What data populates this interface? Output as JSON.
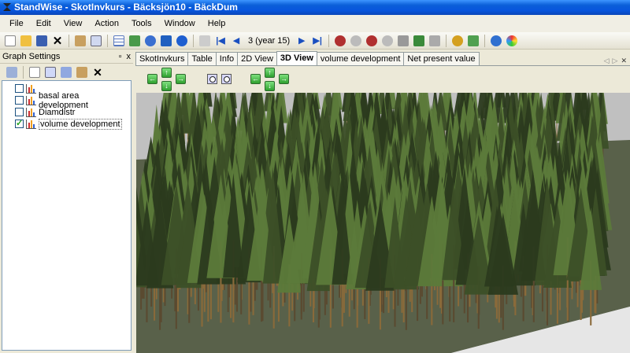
{
  "window": {
    "title": "StandWise - SkotInvkurs - Bäcksjön10 - BäckDum"
  },
  "menu": [
    "File",
    "Edit",
    "View",
    "Action",
    "Tools",
    "Window",
    "Help"
  ],
  "toolbar": {
    "period_label": "3 (year 15)"
  },
  "left_panel": {
    "title": "Graph Settings",
    "pin_label": "†",
    "close_label": "x",
    "items": [
      {
        "label": "",
        "checked": false
      },
      {
        "label": "basal area development",
        "checked": false
      },
      {
        "label": "Diamdistr",
        "checked": false
      },
      {
        "label": "volume development",
        "checked": true
      }
    ]
  },
  "tabs": [
    {
      "label": "SkotInvkurs",
      "active": false
    },
    {
      "label": "Table",
      "active": false
    },
    {
      "label": "Info",
      "active": false
    },
    {
      "label": "2D View",
      "active": false
    },
    {
      "label": "3D View",
      "active": true
    },
    {
      "label": "volume development",
      "active": false
    },
    {
      "label": "Net present value",
      "active": false
    }
  ],
  "colors": {
    "accent": "#0a5fd8",
    "sky": "#c0c0c0",
    "ground": "#5a6248",
    "tree_dark": "#2b3a1d",
    "tree_light": "#5c7a3a"
  }
}
